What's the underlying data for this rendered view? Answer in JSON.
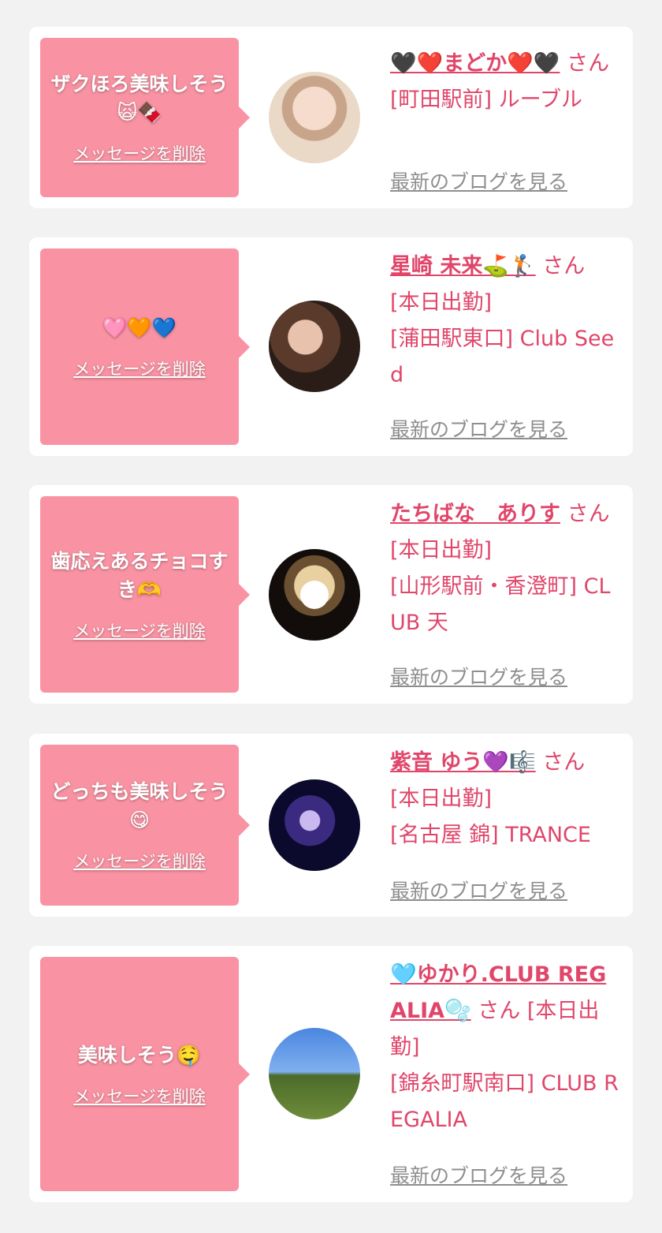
{
  "cards": [
    {
      "message": "ザクほろ美味しそう🙀🍫",
      "delete_label": "メッセージを削除",
      "name": "🖤❤️まどか❤️🖤",
      "honorific": "さん",
      "status": "",
      "shop": "[町田駅前] ルーブル",
      "blog_label": "最新のブログを見る"
    },
    {
      "message": "🩷🧡💙",
      "delete_label": "メッセージを削除",
      "name": "星崎 未来⛳🏌️",
      "honorific": "さん",
      "status": "[本日出勤]",
      "shop": "[蒲田駅東口] Club Seed",
      "blog_label": "最新のブログを見る"
    },
    {
      "message": "歯応えあるチョコすき🫶",
      "delete_label": "メッセージを削除",
      "name": "たちばな　ありす",
      "honorific": "さん",
      "status": "[本日出勤]",
      "shop": "[山形駅前・香澄町] CLUB 天",
      "blog_label": "最新のブログを見る"
    },
    {
      "message": "どっちも美味しそう😋",
      "delete_label": "メッセージを削除",
      "name": "紫音 ゆう💜🎼",
      "honorific": "さん",
      "status": "[本日出勤]",
      "shop": "[名古屋 錦] TRANCE",
      "blog_label": "最新のブログを見る"
    },
    {
      "message": "美味しそう🤤",
      "delete_label": "メッセージを削除",
      "name": "🩵ゆかり.CLUB REGALIA🫧",
      "honorific": "さん",
      "status": "[本日出勤]",
      "shop": "[錦糸町駅南口] CLUB REGALIA",
      "blog_label": "最新のブログを見る"
    }
  ],
  "colors": {
    "background": "#f2f2f2",
    "bubble": "#f993a3",
    "accent": "#e0466a",
    "link_gray": "#8e8e8e"
  }
}
